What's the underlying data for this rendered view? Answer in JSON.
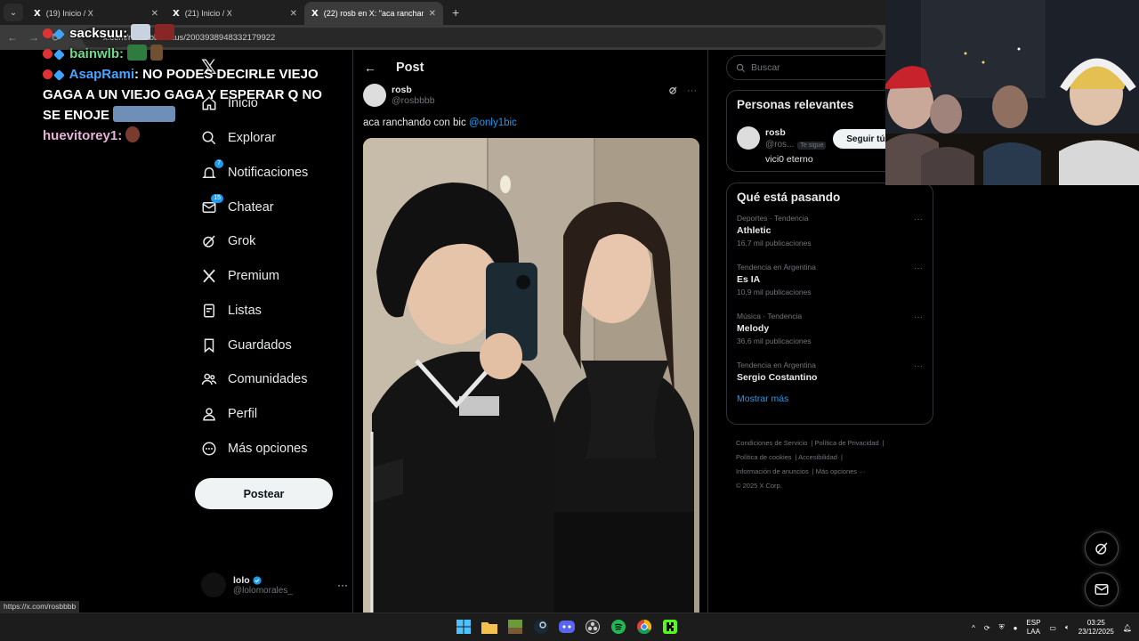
{
  "browser": {
    "tabs": [
      {
        "title": "(19) Inicio / X",
        "active": false
      },
      {
        "title": "(21) Inicio / X",
        "active": false
      },
      {
        "title": "(22) rosb en X: \"aca ranchando",
        "active": true
      }
    ],
    "url": "x.com/rosbbbb/status/2003938948332179922",
    "status_url": "https://x.com/rosbbbb"
  },
  "chat": {
    "lines": [
      {
        "user": "sacksuu:",
        "message": ""
      },
      {
        "user": "bainwlb:",
        "message": ""
      },
      {
        "user": "AsapRami",
        "message": ": NO PODES DECIRLE VIEJO GAGA A UN VIEJO GAGA Y ESPERAR Q NO SE ENOJE"
      },
      {
        "user": "huevitorey1:",
        "message": ""
      }
    ]
  },
  "nav": {
    "items": [
      {
        "label": "Inicio",
        "icon": "home-icon"
      },
      {
        "label": "Explorar",
        "icon": "search-icon"
      },
      {
        "label": "Notificaciones",
        "icon": "bell-icon",
        "badge": "7"
      },
      {
        "label": "Chatear",
        "icon": "mail-icon",
        "badge": "15"
      },
      {
        "label": "Grok",
        "icon": "grok-icon"
      },
      {
        "label": "Premium",
        "icon": "x-icon"
      },
      {
        "label": "Listas",
        "icon": "list-icon"
      },
      {
        "label": "Guardados",
        "icon": "bookmark-icon"
      },
      {
        "label": "Comunidades",
        "icon": "people-icon"
      },
      {
        "label": "Perfil",
        "icon": "person-icon"
      },
      {
        "label": "Más opciones",
        "icon": "more-circle-icon"
      }
    ],
    "post_button": "Postear",
    "account": {
      "name": "lolo",
      "handle": "@lolomorales_"
    }
  },
  "main": {
    "title": "Post",
    "post": {
      "author_name": "rosb",
      "author_handle": "@rosbbbb",
      "text": "aca ranchando con bic ",
      "mention": "@only1bic"
    }
  },
  "right": {
    "search_placeholder": "Buscar",
    "relevant": {
      "title": "Personas relevantes",
      "name": "rosb",
      "handle": "@ros...",
      "follows_you": "Te sigue",
      "bio": "vici0 eterno",
      "follow_button": "Seguir tú t"
    },
    "trends": {
      "title": "Qué está pasando",
      "items": [
        {
          "category": "Deportes · Tendencia",
          "name": "Athletic",
          "count": "16,7 mil publicaciones"
        },
        {
          "category": "Tendencia en Argentina",
          "name": "Es IA",
          "count": "10,9 mil publicaciones"
        },
        {
          "category": "Música · Tendencia",
          "name": "Melody",
          "count": "36,6 mil publicaciones"
        },
        {
          "category": "Tendencia en Argentina",
          "name": "Sergio Costantino",
          "count": ""
        }
      ],
      "show_more": "Mostrar más"
    },
    "footer": [
      "Condiciones de Servicio",
      "Política de Privacidad",
      "Política de cookies",
      "Accesibilidad",
      "Información de anuncios",
      "Más opciones ···",
      "© 2025 X Corp."
    ]
  },
  "taskbar": {
    "lang_top": "ESP",
    "lang_bottom": "LAA",
    "time": "03:25",
    "date": "23/12/2025"
  }
}
